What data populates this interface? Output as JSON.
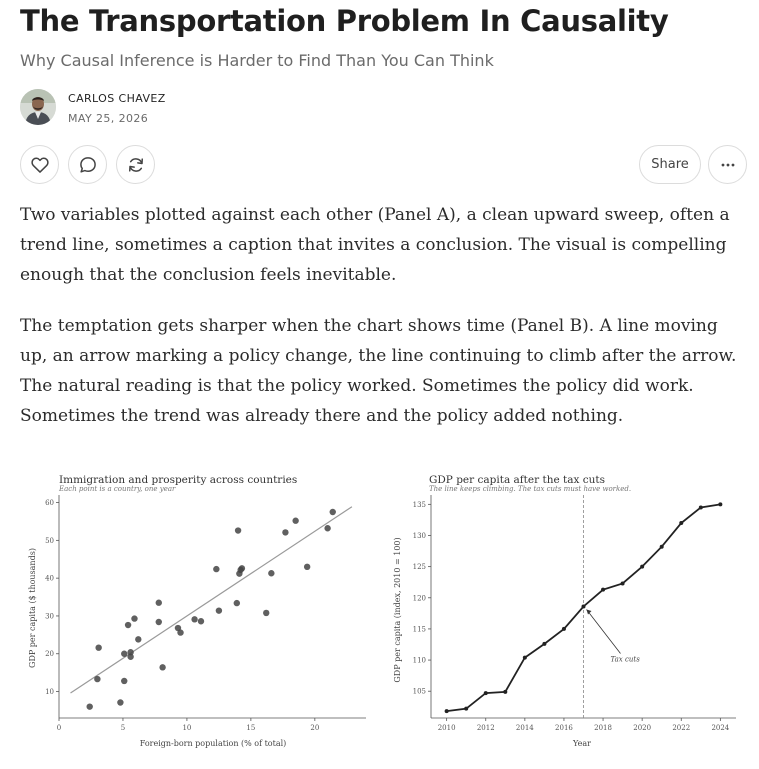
{
  "article": {
    "title": "The Transportation Problem In Causality",
    "subtitle": "Why Causal Inference is Harder to Find Than You Can Think",
    "author": "CARLOS CHAVEZ",
    "date": "MAY 25, 2026",
    "share_label": "Share",
    "paragraphs": [
      "Two variables plotted against each other (Panel A), a clean upward sweep, often a trend line, sometimes a caption that invites a conclusion. The visual is compelling enough that the conclusion feels inevitable.",
      "The temptation gets sharper when the chart shows time (Panel B). A line moving up, an arrow marking a policy change, the line continuing to climb after the arrow. The natural reading is that the policy worked. Sometimes the policy did work. Sometimes the trend was already there and the policy added nothing."
    ]
  },
  "icons": {
    "like": "heart-icon",
    "comment": "comment-icon",
    "restack": "restack-icon",
    "more": "more-icon"
  },
  "colors": {
    "text": "#242424",
    "muted": "#6b6b6b",
    "border": "#dcdcdc",
    "points": "#444444",
    "trend": "#9a9a9a"
  },
  "chart_data": [
    {
      "type": "scatter",
      "title": "Immigration and prosperity across countries",
      "subtitle": "Each point is a country, one year",
      "xlabel": "Foreign-born population (% of total)",
      "ylabel": "GDP per capita ($ thousands)",
      "xlim": [
        0,
        24
      ],
      "ylim": [
        3,
        62
      ],
      "xticks": [
        0,
        5,
        10,
        15,
        20
      ],
      "yticks": [
        10,
        20,
        30,
        40,
        50,
        60
      ],
      "points": [
        [
          2.4,
          6
        ],
        [
          3.0,
          13.3
        ],
        [
          3.1,
          21.6
        ],
        [
          4.8,
          7.1
        ],
        [
          5.1,
          12.8
        ],
        [
          5.1,
          20
        ],
        [
          5.4,
          27.6
        ],
        [
          5.6,
          20.4
        ],
        [
          5.6,
          19.2
        ],
        [
          5.9,
          29.3
        ],
        [
          6.2,
          23.8
        ],
        [
          7.8,
          33.5
        ],
        [
          7.8,
          28.4
        ],
        [
          8.1,
          16.4
        ],
        [
          9.3,
          26.8
        ],
        [
          9.5,
          25.6
        ],
        [
          10.6,
          29.1
        ],
        [
          11.1,
          28.6
        ],
        [
          12.3,
          42.4
        ],
        [
          12.5,
          31.4
        ],
        [
          13.9,
          33.4
        ],
        [
          14.0,
          52.6
        ],
        [
          14.1,
          41.2
        ],
        [
          14.2,
          42.2
        ],
        [
          14.3,
          42.6
        ],
        [
          16.2,
          30.8
        ],
        [
          16.6,
          41.3
        ],
        [
          17.7,
          52.1
        ],
        [
          18.5,
          55.2
        ],
        [
          19.4,
          43
        ],
        [
          21.0,
          53.2
        ],
        [
          21.4,
          57.5
        ]
      ],
      "trend_line": [
        [
          0.9,
          9.6
        ],
        [
          22.9,
          58.9
        ]
      ]
    },
    {
      "type": "line",
      "title": "GDP per capita after the tax cuts",
      "subtitle": "The line keeps climbing. The tax cuts must have worked.",
      "xlabel": "Year",
      "ylabel": "GDP per capita (index, 2010 = 100)",
      "xlim": [
        2009.2,
        2024.8
      ],
      "ylim": [
        100.7,
        136.5
      ],
      "xticks": [
        2010,
        2012,
        2014,
        2016,
        2018,
        2020,
        2022,
        2024
      ],
      "yticks": [
        105,
        110,
        115,
        120,
        125,
        130,
        135
      ],
      "x": [
        2010,
        2011,
        2012,
        2013,
        2014,
        2015,
        2016,
        2017,
        2018,
        2019,
        2020,
        2021,
        2022,
        2023,
        2024
      ],
      "y": [
        101.8,
        102.2,
        104.7,
        104.9,
        110.4,
        112.6,
        115.0,
        118.6,
        121.3,
        122.3,
        125.0,
        128.2,
        132.0,
        134.5,
        135.0
      ],
      "policy_year": 2017,
      "annotation": "Tax cuts"
    }
  ]
}
